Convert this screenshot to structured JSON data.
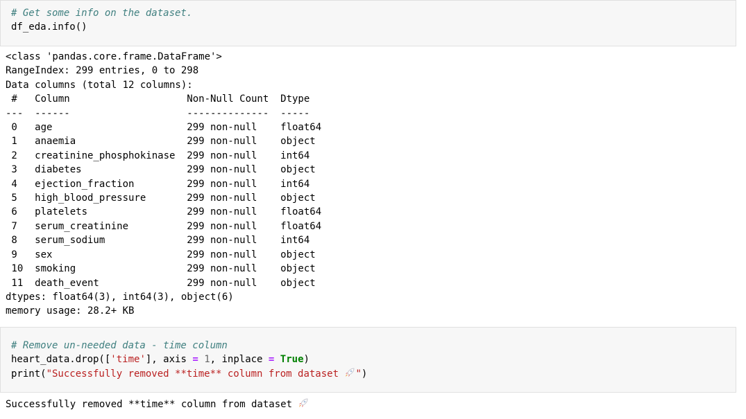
{
  "cell1": {
    "comment": "# Get some info on the dataset.",
    "code": "df_eda.info()"
  },
  "output1": {
    "lines": [
      "<class 'pandas.core.frame.DataFrame'>",
      "RangeIndex: 299 entries, 0 to 298",
      "Data columns (total 12 columns):",
      " #   Column                    Non-Null Count  Dtype  ",
      "---  ------                    --------------  -----  ",
      " 0   age                       299 non-null    float64",
      " 1   anaemia                   299 non-null    object ",
      " 2   creatinine_phosphokinase  299 non-null    int64  ",
      " 3   diabetes                  299 non-null    object ",
      " 4   ejection_fraction         299 non-null    int64  ",
      " 5   high_blood_pressure       299 non-null    object ",
      " 6   platelets                 299 non-null    float64",
      " 7   serum_creatinine          299 non-null    float64",
      " 8   serum_sodium              299 non-null    int64  ",
      " 9   sex                       299 non-null    object ",
      " 10  smoking                   299 non-null    object ",
      " 11  death_event               299 non-null    object ",
      "dtypes: float64(3), int64(3), object(6)",
      "memory usage: 28.2+ KB"
    ]
  },
  "cell2": {
    "comment": "# Remove un-needed data - time column",
    "line2": {
      "a": "heart_data.drop([",
      "s1": "'time'",
      "b": "], axis ",
      "eq1": "=",
      "c": " ",
      "one": "1",
      "d": ", inplace ",
      "eq2": "=",
      "e": " ",
      "true": "True",
      "f": ")"
    },
    "line3": {
      "a": "print(",
      "s1": "\"Successfully removed **time** column from dataset ",
      "s2": "\"",
      "f": ")"
    }
  },
  "output2": {
    "text": "Successfully removed **time** column from dataset "
  },
  "icons": {
    "emoji": "rocket-icon"
  }
}
